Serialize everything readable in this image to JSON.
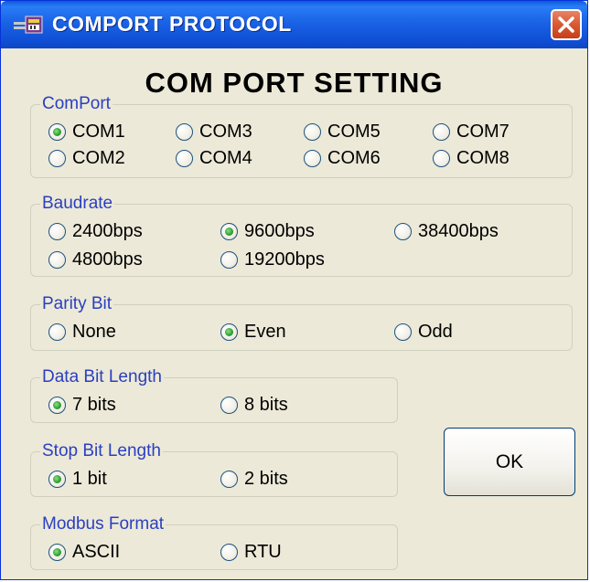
{
  "window": {
    "title": "COMPORT PROTOCOL"
  },
  "heading": "COM PORT SETTING",
  "comport": {
    "legend": "ComPort",
    "selected": "COM1",
    "options": [
      "COM1",
      "COM3",
      "COM5",
      "COM7",
      "COM2",
      "COM4",
      "COM6",
      "COM8"
    ]
  },
  "baudrate": {
    "legend": "Baudrate",
    "selected": "9600bps",
    "options": [
      "2400bps",
      "9600bps",
      "38400bps",
      "4800bps",
      "19200bps"
    ]
  },
  "parity": {
    "legend": "Parity Bit",
    "selected": "Even",
    "options": [
      "None",
      "Even",
      "Odd"
    ]
  },
  "data_bits": {
    "legend": "Data Bit Length",
    "selected": "7 bits",
    "options": [
      "7 bits",
      "8 bits"
    ]
  },
  "stop_bits": {
    "legend": "Stop Bit Length",
    "selected": "1 bit",
    "options": [
      "1 bit",
      "2 bits"
    ]
  },
  "modbus": {
    "legend": "Modbus Format",
    "selected": "ASCII",
    "options": [
      "ASCII",
      "RTU"
    ]
  },
  "ok_label": "OK",
  "icons": {
    "app": "serial-port-app-icon",
    "close": "close-icon",
    "radio": "radio-button"
  },
  "colors": {
    "titlebar": "#0f4ed4",
    "legend_text": "#2a3fc0",
    "close_button": "#d9582f",
    "radio_dot": "#33a433"
  }
}
